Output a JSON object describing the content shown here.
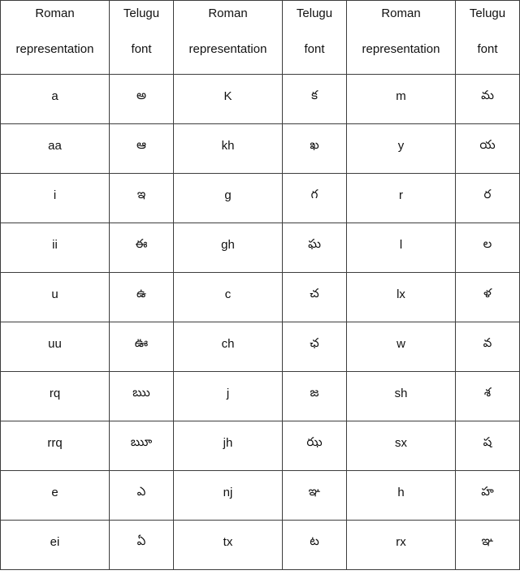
{
  "document": {
    "kind": "transliteration-table",
    "title": "Telugu transliteration reference table",
    "border_color": "#3d3d3d",
    "background_color": "#ffffff",
    "text_color": "#111111"
  },
  "table": {
    "column_count": 6,
    "data_row_count": 10,
    "header_labels": {
      "roman_line1": "Roman",
      "roman_line2": "representation",
      "telugu_line1": "Telugu",
      "telugu_line2": "font"
    },
    "columns": [
      {
        "key": "roman_1",
        "type": "roman",
        "line1": "Roman",
        "line2": "representation"
      },
      {
        "key": "telugu_1",
        "type": "telugu",
        "line1": "Telugu",
        "line2": "font"
      },
      {
        "key": "roman_2",
        "type": "roman",
        "line1": "Roman",
        "line2": "representation"
      },
      {
        "key": "telugu_2",
        "type": "telugu",
        "line1": "Telugu",
        "line2": "font"
      },
      {
        "key": "roman_3",
        "type": "roman",
        "line1": "Roman",
        "line2": "representation"
      },
      {
        "key": "telugu_3",
        "type": "telugu",
        "line1": "Telugu",
        "line2": "font"
      }
    ],
    "rows": [
      {
        "roman_1": "a",
        "telugu_1": "అ",
        "roman_2": "K",
        "telugu_2": "క",
        "roman_3": "m",
        "telugu_3": "మ"
      },
      {
        "roman_1": "aa",
        "telugu_1": "ఆ",
        "roman_2": "kh",
        "telugu_2": "ఖ",
        "roman_3": "y",
        "telugu_3": "య"
      },
      {
        "roman_1": "i",
        "telugu_1": "ఇ",
        "roman_2": "g",
        "telugu_2": "గ",
        "roman_3": "r",
        "telugu_3": "ర"
      },
      {
        "roman_1": "ii",
        "telugu_1": "ఈ",
        "roman_2": "gh",
        "telugu_2": "ఘ",
        "roman_3": "l",
        "telugu_3": "ల"
      },
      {
        "roman_1": "u",
        "telugu_1": "ఉ",
        "roman_2": "c",
        "telugu_2": "చ",
        "roman_3": "lx",
        "telugu_3": "ళ"
      },
      {
        "roman_1": "uu",
        "telugu_1": "ఊ",
        "roman_2": "ch",
        "telugu_2": "ఛ",
        "roman_3": "w",
        "telugu_3": "వ"
      },
      {
        "roman_1": "rq",
        "telugu_1": "ఋ",
        "roman_2": "j",
        "telugu_2": "జ",
        "roman_3": "sh",
        "telugu_3": "శ"
      },
      {
        "roman_1": "rrq",
        "telugu_1": "ౠ",
        "roman_2": "jh",
        "telugu_2": "ఝ",
        "roman_3": "sx",
        "telugu_3": "ష"
      },
      {
        "roman_1": "e",
        "telugu_1": "ఎ",
        "roman_2": "nj",
        "telugu_2": "ఞ",
        "roman_3": "h",
        "telugu_3": "హ"
      },
      {
        "roman_1": "ei",
        "telugu_1": "ఏ",
        "roman_2": "tx",
        "telugu_2": "ట",
        "roman_3": "rx",
        "telugu_3": "ఞ"
      }
    ]
  }
}
